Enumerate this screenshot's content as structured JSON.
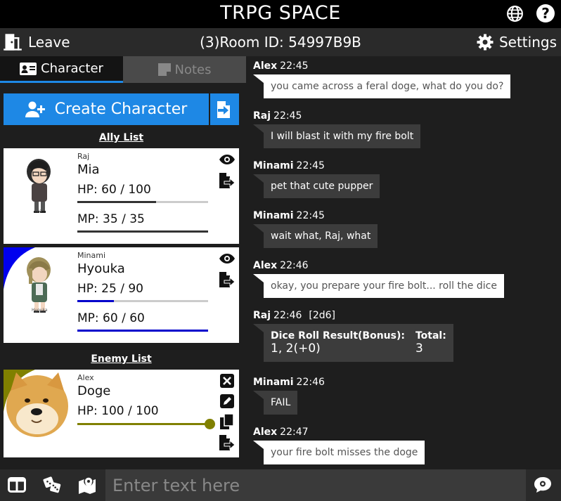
{
  "app": {
    "title": "TRPG SPACE"
  },
  "nav": {
    "leave_label": "Leave",
    "room_label": "(3)Room ID: 54997B9B",
    "settings_label": "Settings"
  },
  "tabs": [
    {
      "label": "Character",
      "active": true
    },
    {
      "label": "Notes",
      "active": false
    }
  ],
  "left": {
    "create_label": "Create Character",
    "ally_title": "Ally List",
    "enemy_title": "Enemy List",
    "allies": [
      {
        "owner": "Raj",
        "name": "Mia",
        "hp_label": "HP",
        "hp_value": ": 60 / 100",
        "hp_ratio": 0.6,
        "mp_label": "MP",
        "mp_value": ": 35 / 35",
        "mp_ratio": 1.0,
        "color": "#ffffff",
        "bar_color": "#333333",
        "portrait_caption": "Mia"
      },
      {
        "owner": "Minami",
        "name": "Hyouka",
        "hp_label": "HP",
        "hp_value": ": 25 / 90",
        "hp_ratio": 0.28,
        "mp_label": "MP",
        "mp_value": ": 60 / 60",
        "mp_ratio": 1.0,
        "color": "#0000ee",
        "bar_color": "#0000cc",
        "portrait_caption": "Hyouka"
      }
    ],
    "enemies": [
      {
        "owner": "Alex",
        "name": "Doge",
        "hp_label": "HP",
        "hp_value": ": 100 / 100",
        "hp_ratio": 1.0,
        "color": "#808000",
        "bar_color": "#808000"
      }
    ]
  },
  "chat": {
    "messages": [
      {
        "user": "Alex",
        "time": "22:45",
        "text": "you came across a feral doge, what do you do?",
        "style": "white"
      },
      {
        "user": "Raj",
        "time": "22:45",
        "text": "I will blast it with my fire bolt",
        "style": "dark"
      },
      {
        "user": "Minami",
        "time": "22:45",
        "text": "pet that cute pupper",
        "style": "dark"
      },
      {
        "user": "Minami",
        "time": "22:45",
        "text": "wait what, Raj, what",
        "style": "dark"
      },
      {
        "user": "Alex",
        "time": "22:46",
        "text": "okay, you prepare your fire bolt... roll the dice",
        "style": "white"
      },
      {
        "user": "Raj",
        "time": "22:46",
        "extra": "[2d6]",
        "dice": {
          "result_header": "Dice Roll Result(Bonus):",
          "result_value": "1, 2(+0)",
          "total_header": "Total:",
          "total_value": "3"
        },
        "style": "dark"
      },
      {
        "user": "Minami",
        "time": "22:46",
        "text": "FAIL",
        "style": "dark"
      },
      {
        "user": "Alex",
        "time": "22:47",
        "text": "your fire bolt misses the doge",
        "style": "white"
      }
    ]
  },
  "input": {
    "placeholder": "Enter text here"
  },
  "icons": [
    "globe-icon",
    "help-icon",
    "door-icon",
    "gear-icon",
    "id-card-icon",
    "note-icon",
    "add-user-icon",
    "import-icon",
    "eye-icon",
    "export-icon",
    "close-icon",
    "pencil-icon",
    "copy-icon",
    "layout-icon",
    "dice-icon",
    "map-icon",
    "chat-icon"
  ]
}
